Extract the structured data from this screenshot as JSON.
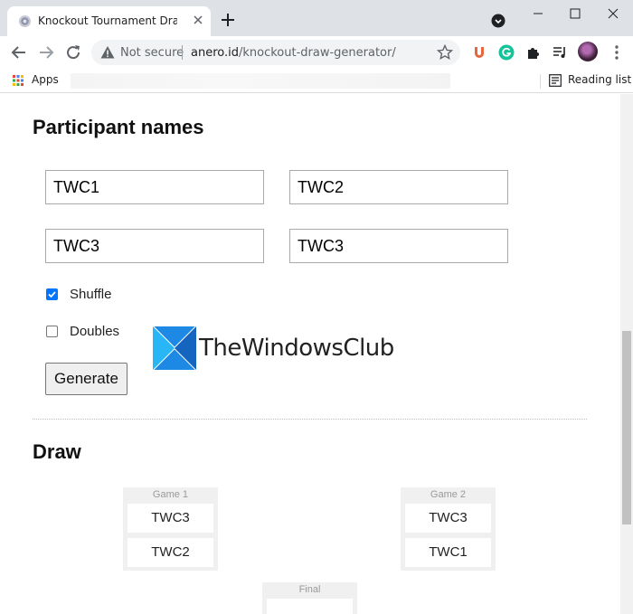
{
  "browser": {
    "tab_title": "Knockout Tournament Draw Generator",
    "security_label": "Not secure",
    "url_host": "anero.id",
    "url_path": "/knockout-draw-generator/",
    "bookmarks": {
      "apps_label": "Apps",
      "reading_list_label": "Reading list"
    }
  },
  "page": {
    "participants_heading": "Participant names",
    "participants": [
      "TWC1",
      "TWC2",
      "TWC3",
      "TWC3"
    ],
    "options": {
      "shuffle_label": "Shuffle",
      "shuffle_checked": true,
      "doubles_label": "Doubles",
      "doubles_checked": false
    },
    "generate_label": "Generate",
    "watermark": "TheWindowsClub",
    "draw_heading": "Draw",
    "games": [
      {
        "title": "Game 1",
        "players": [
          "TWC3",
          "TWC2"
        ]
      },
      {
        "title": "Game 2",
        "players": [
          "TWC3",
          "TWC1"
        ]
      }
    ],
    "final_title": "Final"
  },
  "colors": {
    "accent": "#0075ff",
    "tab_strip": "#dee1e6"
  }
}
